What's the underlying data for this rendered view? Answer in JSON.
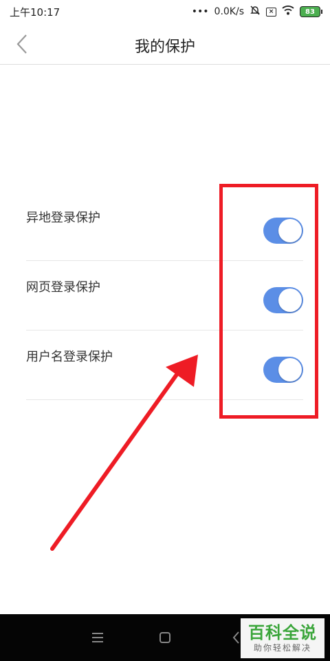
{
  "status_bar": {
    "time": "上午10:17",
    "dots": "•••",
    "network_speed": "0.0K/s",
    "battery_level": "83"
  },
  "header": {
    "title": "我的保护"
  },
  "settings": [
    {
      "label": "异地登录保护",
      "enabled": true
    },
    {
      "label": "网页登录保护",
      "enabled": true
    },
    {
      "label": "用户名登录保护",
      "enabled": true
    }
  ],
  "annotation": {
    "box_color": "#ee1c25",
    "arrow_color": "#ee1c25"
  },
  "toggle_color": "#5b8ee6",
  "watermark": {
    "title": "百科全说",
    "subtitle": "助你轻松解决"
  }
}
